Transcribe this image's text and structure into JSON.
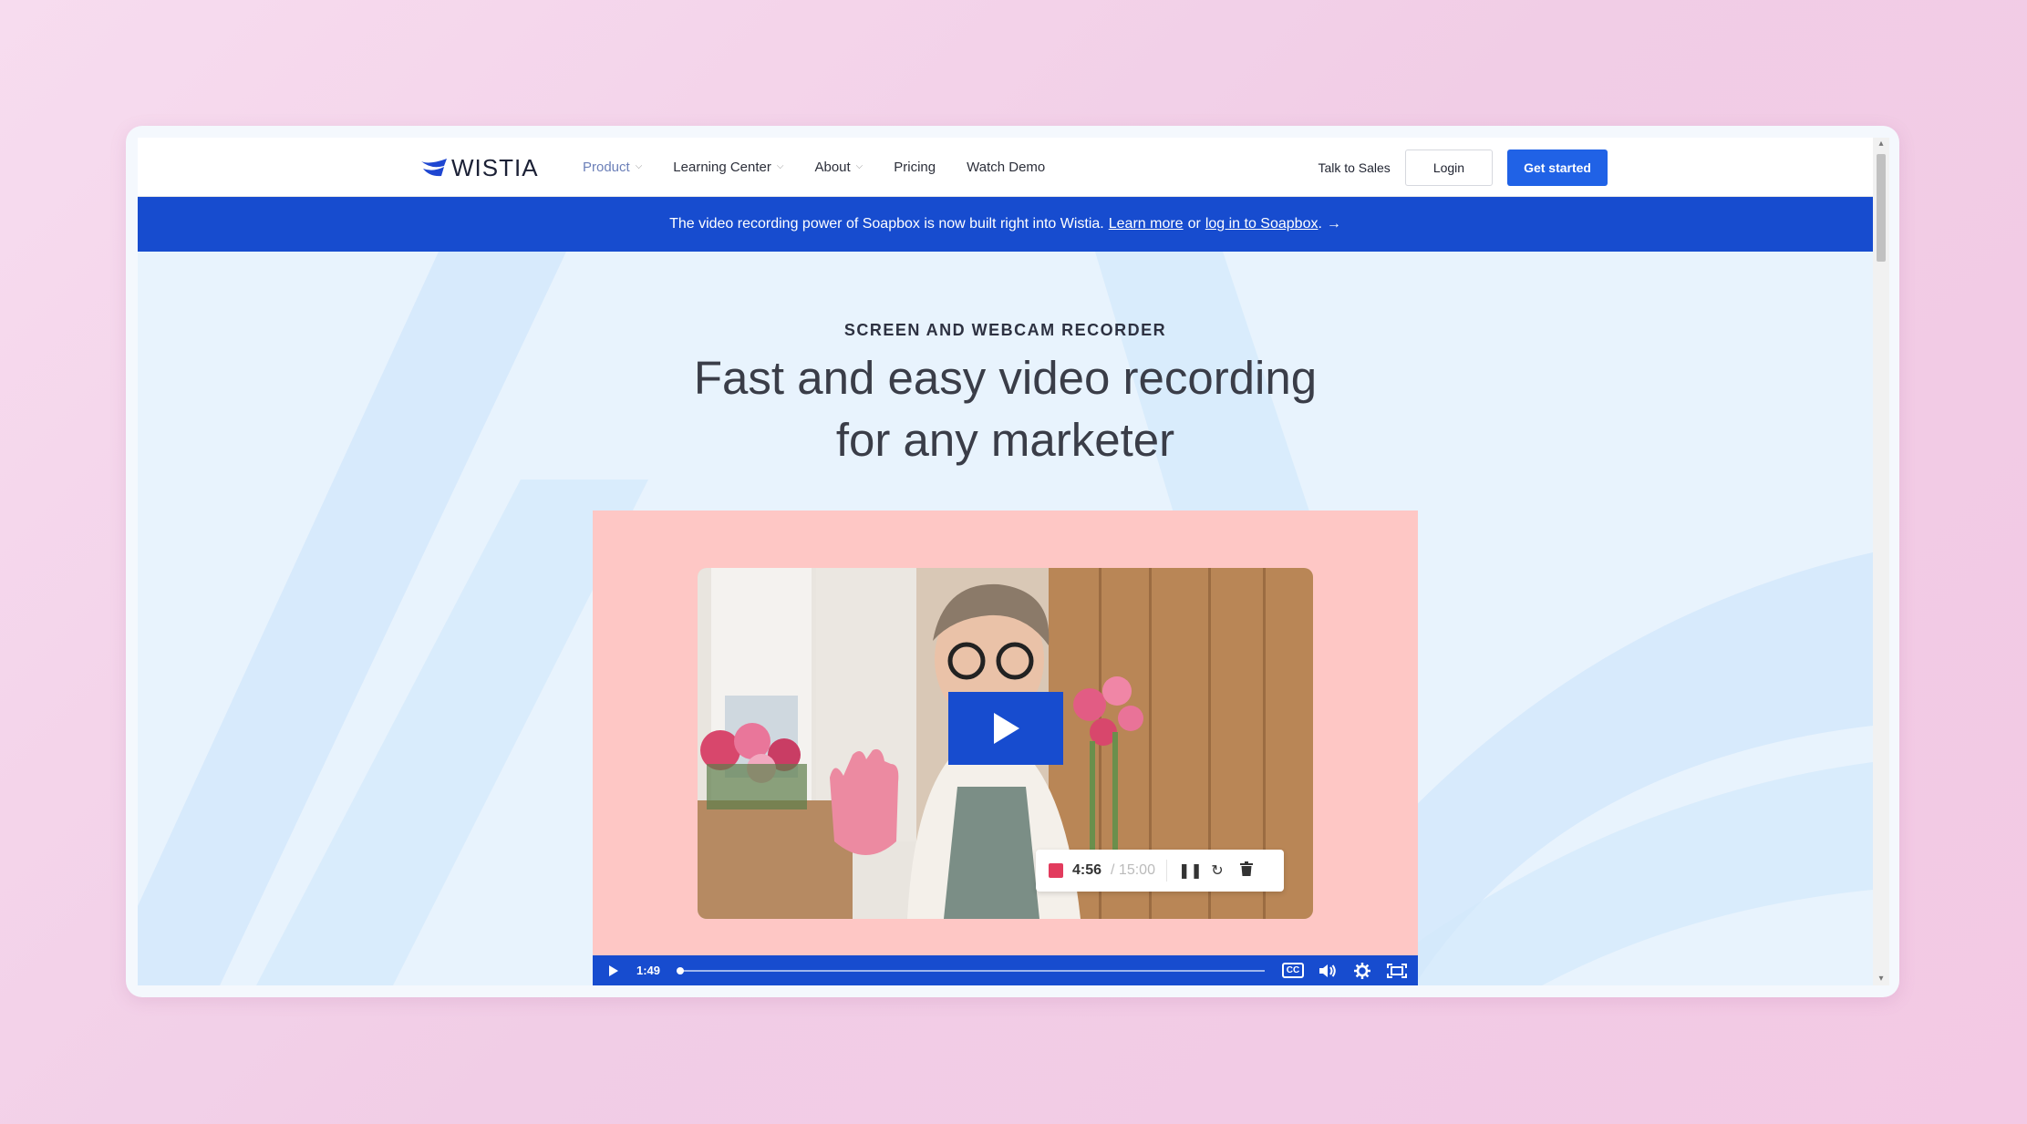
{
  "header": {
    "logo_text": "WISTIA",
    "nav": [
      {
        "label": "Product",
        "has_dropdown": true,
        "active": true
      },
      {
        "label": "Learning Center",
        "has_dropdown": true,
        "active": false
      },
      {
        "label": "About",
        "has_dropdown": true,
        "active": false
      },
      {
        "label": "Pricing",
        "has_dropdown": false,
        "active": false
      },
      {
        "label": "Watch Demo",
        "has_dropdown": false,
        "active": false
      }
    ],
    "talk_to_sales": "Talk to Sales",
    "login": "Login",
    "get_started": "Get started"
  },
  "banner": {
    "text": "The video recording power of Soapbox is now built right into Wistia.",
    "learn_more": "Learn more",
    "or": "or",
    "login_link": "log in to Soapbox",
    "suffix": ".",
    "arrow": "→"
  },
  "hero": {
    "eyebrow": "SCREEN AND WEBCAM RECORDER",
    "headline_line1": "Fast and easy video recording",
    "headline_line2": "for any marketer"
  },
  "video": {
    "recorder": {
      "elapsed": "4:56",
      "total": "/ 15:00"
    },
    "controls": {
      "time": "1:49",
      "cc": "CC",
      "progress_fraction": 0.0
    }
  },
  "colors": {
    "brand_blue": "#174ccf",
    "button_blue": "#2062e6",
    "video_bg": "#fec7c5",
    "record_red": "#e23b5d"
  }
}
